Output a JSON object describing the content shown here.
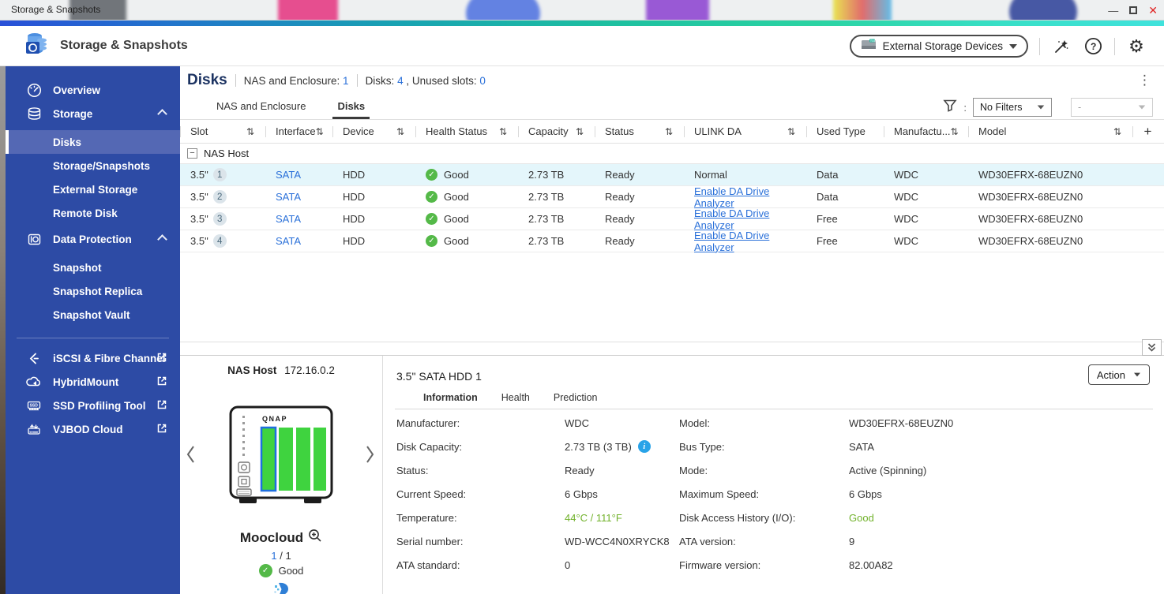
{
  "window": {
    "title": "Storage & Snapshots"
  },
  "header": {
    "app_title": "Storage & Snapshots",
    "external_devices_button": "External Storage Devices"
  },
  "sidebar": {
    "overview": "Overview",
    "storage": "Storage",
    "disks": "Disks",
    "storage_snapshots": "Storage/Snapshots",
    "external_storage": "External Storage",
    "remote_disk": "Remote Disk",
    "data_protection": "Data Protection",
    "snapshot": "Snapshot",
    "snapshot_replica": "Snapshot Replica",
    "snapshot_vault": "Snapshot Vault",
    "iscsi": "iSCSI & Fibre Channel",
    "hybridmount": "HybridMount",
    "ssd_profiling": "SSD Profiling Tool",
    "vjbod_cloud": "VJBOD Cloud"
  },
  "page": {
    "title": "Disks",
    "nas_enclosure_label": "NAS and Enclosure:",
    "nas_enclosure_value": "1",
    "disks_label": "Disks:",
    "disks_value": "4",
    "unused_label": ", Unused slots:",
    "unused_value": "0"
  },
  "tabs": {
    "nas_and_enclosure": "NAS and Enclosure",
    "disks": "Disks"
  },
  "filters": {
    "colon": ":",
    "primary": "No Filters",
    "secondary": "-"
  },
  "table": {
    "columns": {
      "slot": "Slot",
      "interface": "Interface",
      "device": "Device",
      "health": "Health Status",
      "capacity": "Capacity",
      "status": "Status",
      "ulink": "ULINK DA",
      "used": "Used Type",
      "manufacturer": "Manufactu...",
      "model": "Model"
    },
    "group": "NAS Host",
    "rows": [
      {
        "size": "3.5\"",
        "num": "1",
        "interface": "SATA",
        "device": "HDD",
        "health": "Good",
        "capacity": "2.73 TB",
        "status": "Ready",
        "ulink": "Normal",
        "used": "Data",
        "manufacturer": "WDC",
        "model": "WD30EFRX-68EUZN0"
      },
      {
        "size": "3.5\"",
        "num": "2",
        "interface": "SATA",
        "device": "HDD",
        "health": "Good",
        "capacity": "2.73 TB",
        "status": "Ready",
        "ulink": "Enable DA Drive Analyzer",
        "used": "Data",
        "manufacturer": "WDC",
        "model": "WD30EFRX-68EUZN0"
      },
      {
        "size": "3.5\"",
        "num": "3",
        "interface": "SATA",
        "device": "HDD",
        "health": "Good",
        "capacity": "2.73 TB",
        "status": "Ready",
        "ulink": "Enable DA Drive Analyzer",
        "used": "Free",
        "manufacturer": "WDC",
        "model": "WD30EFRX-68EUZN0"
      },
      {
        "size": "3.5\"",
        "num": "4",
        "interface": "SATA",
        "device": "HDD",
        "health": "Good",
        "capacity": "2.73 TB",
        "status": "Ready",
        "ulink": "Enable DA Drive Analyzer",
        "used": "Free",
        "manufacturer": "WDC",
        "model": "WD30EFRX-68EUZN0"
      }
    ]
  },
  "nas_panel": {
    "host_label": "NAS Host",
    "host_ip": "172.16.0.2",
    "brand": "QNAP",
    "name": "Moocloud",
    "page_current": "1",
    "page_separator": "/",
    "page_total": "1",
    "health": "Good"
  },
  "details": {
    "title": "3.5\" SATA HDD 1",
    "action_button": "Action",
    "tabs": {
      "information": "Information",
      "health": "Health",
      "prediction": "Prediction"
    },
    "left": [
      {
        "label": "Manufacturer:",
        "value": "WDC"
      },
      {
        "label": "Disk Capacity:",
        "value": "2.73 TB (3 TB)"
      },
      {
        "label": "Status:",
        "value": "Ready"
      },
      {
        "label": "Current Speed:",
        "value": "6 Gbps"
      },
      {
        "label": "Temperature:",
        "value": "44°C / 111°F"
      },
      {
        "label": "Serial number:",
        "value": "WD-WCC4N0XRYCK8"
      },
      {
        "label": "ATA standard:",
        "value": "0"
      }
    ],
    "right": [
      {
        "label": "Model:",
        "value": "WD30EFRX-68EUZN0"
      },
      {
        "label": "Bus Type:",
        "value": "SATA"
      },
      {
        "label": "Mode:",
        "value": "Active (Spinning)"
      },
      {
        "label": "Maximum Speed:",
        "value": "6 Gbps"
      },
      {
        "label": "Disk Access History (I/O):",
        "value": "Good"
      },
      {
        "label": "ATA version:",
        "value": "9"
      },
      {
        "label": "Firmware version:",
        "value": "82.00A82"
      }
    ]
  },
  "colors": {
    "accent_blue": "#2a70d9",
    "sidebar_blue": "#2d4ba5",
    "good_green": "#54b948",
    "row_highlight": "#e4f6fb"
  }
}
